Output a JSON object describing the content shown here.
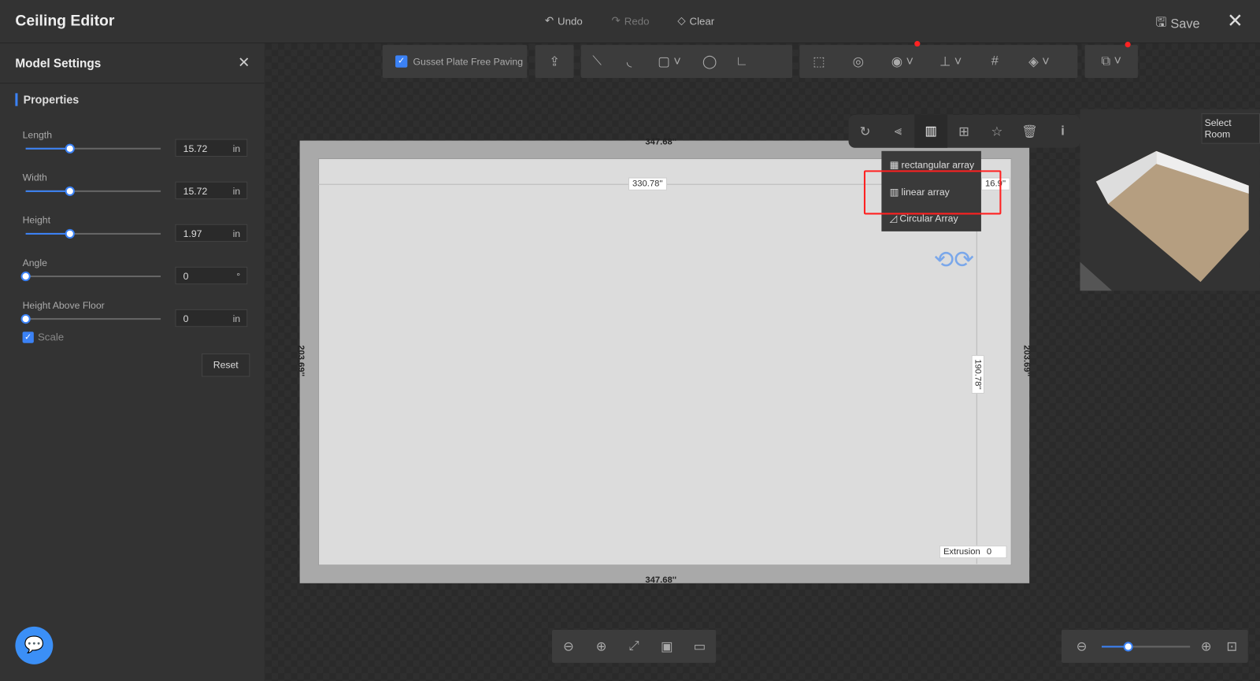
{
  "app": {
    "title": "Ceiling Editor",
    "undo": "Undo",
    "redo": "Redo",
    "clear": "Clear",
    "save": "Save"
  },
  "panel": {
    "title": "Model Settings",
    "section": "Properties",
    "fields": [
      {
        "label": "Length",
        "value": "15.72",
        "unit": "in",
        "slider": 0.33
      },
      {
        "label": "Width",
        "value": "15.72",
        "unit": "in",
        "slider": 0.33
      },
      {
        "label": "Height",
        "value": "1.97",
        "unit": "in",
        "slider": 0.33
      },
      {
        "label": "Angle",
        "value": "0",
        "unit": "°",
        "slider": 0
      },
      {
        "label": "Height Above Floor",
        "value": "0",
        "unit": "in",
        "slider": 0
      }
    ],
    "scale_label": "Scale",
    "scale_checked": true,
    "reset": "Reset"
  },
  "toolbar": {
    "gusset_label": "Gusset Plate Free Paving",
    "gusset_checked": true
  },
  "context_menu": {
    "items": [
      "rectangular array",
      "linear array",
      "Circular Array"
    ],
    "highlighted": "linear array"
  },
  "dimensions": {
    "top": "347.68''",
    "bottom": "347.68''",
    "left": "203.69''",
    "right": "203.69''",
    "inner_width": "330.78''",
    "inner_height": "190.78''",
    "offset": "16.9''",
    "extrusion_label": "Extrusion",
    "extrusion_value": "0"
  },
  "preview": {
    "select_room": "Select Room"
  },
  "zoom": {
    "level": 0.3
  },
  "colors": {
    "accent": "#3b82f6",
    "highlight": "#ff2020"
  }
}
